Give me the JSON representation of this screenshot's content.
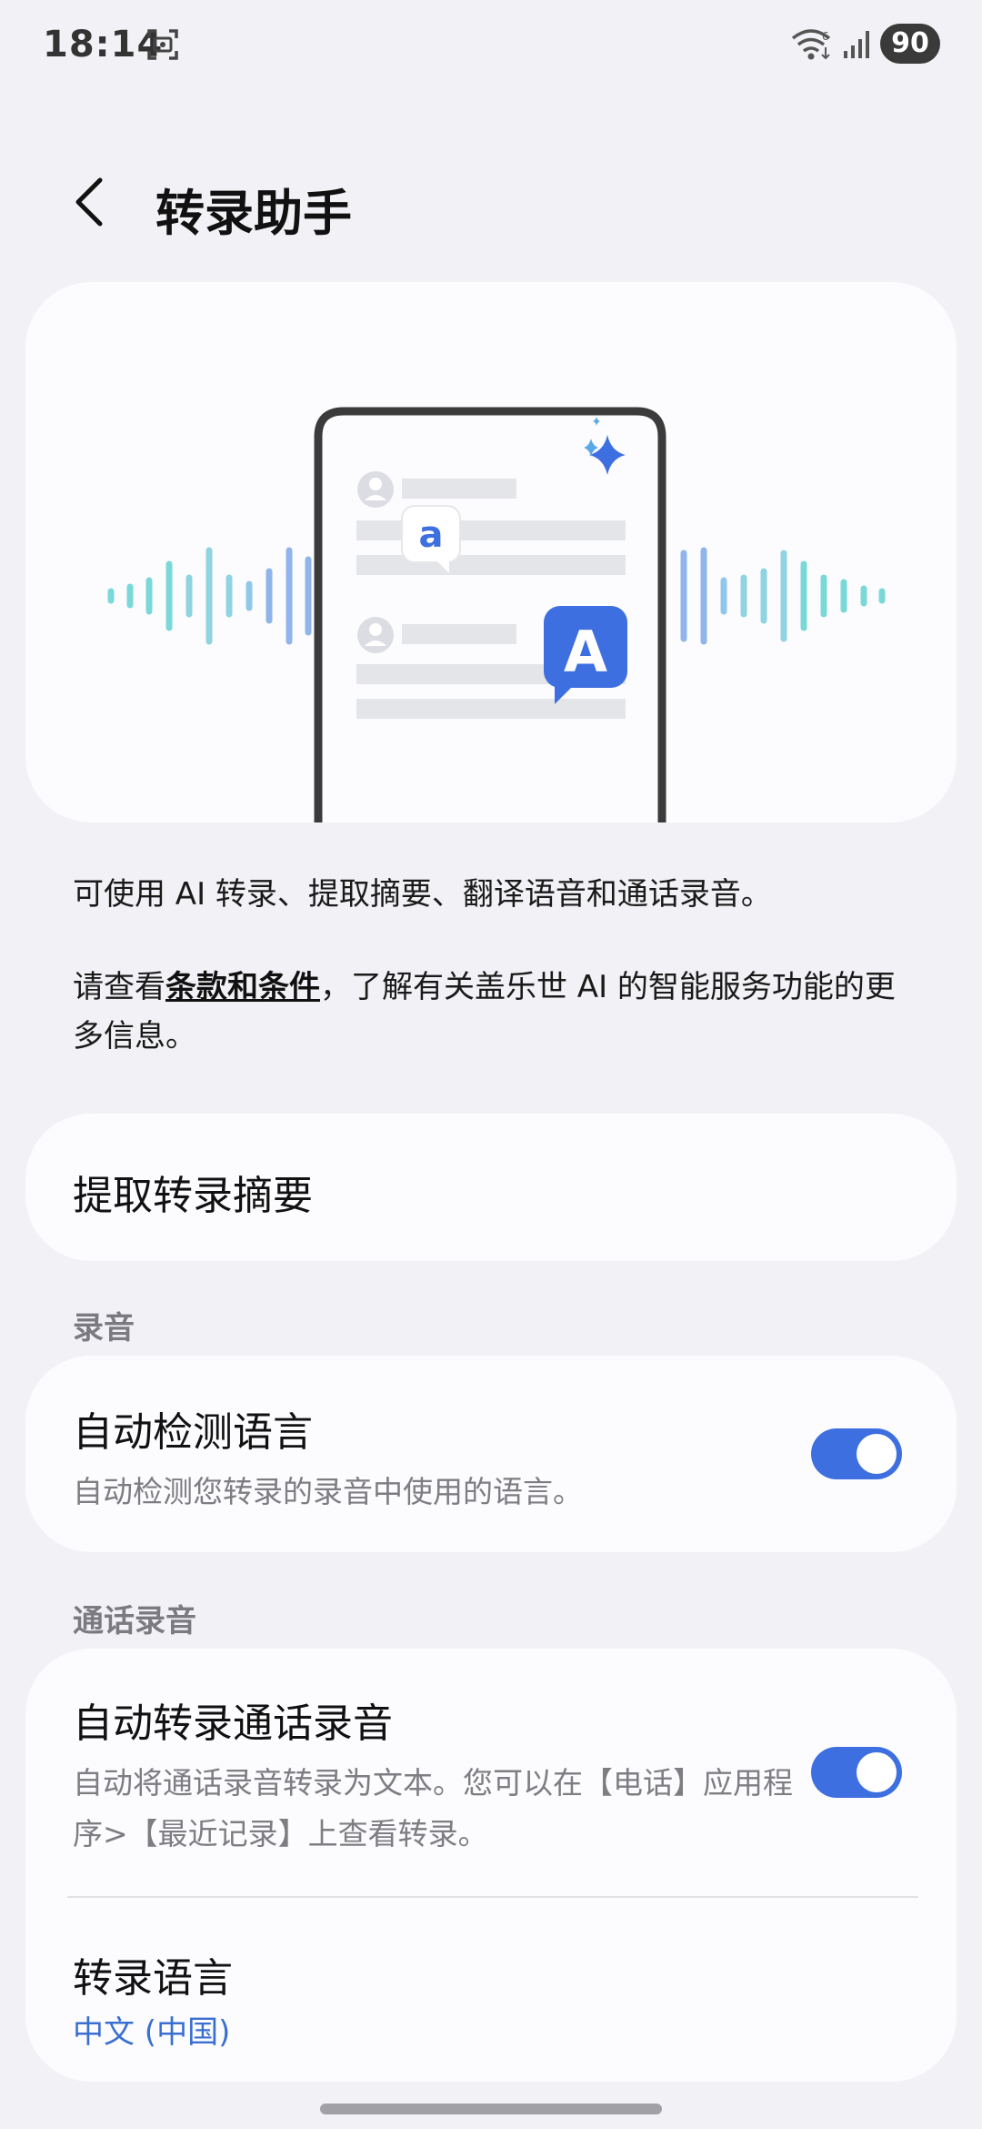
{
  "status_bar": {
    "time": "18:14",
    "battery": "90",
    "icons": [
      "screenshot-icon",
      "wifi-icon",
      "signal-icon"
    ]
  },
  "header": {
    "title": "转录助手",
    "back_icon": "chevron-left-icon"
  },
  "hero": {
    "bubble_small_letter": "a",
    "bubble_large_letter": "A",
    "sparkle_icon": "sparkle-icon",
    "accent_color": "#3d6fe0",
    "wave_color_left": "#7ad9d8",
    "wave_color_right": "#8fb5ea"
  },
  "description": {
    "line1": "可使用 AI 转录、提取摘要、翻译语音和通话录音。",
    "line2_before": "请查看",
    "terms_link": "条款和条件",
    "line2_after": "，了解有关盖乐世 AI 的智能服务功能的更多信息。"
  },
  "summary_row": {
    "title": "提取转录摘要"
  },
  "recording_section": {
    "header": "录音",
    "auto_detect": {
      "title": "自动检测语言",
      "subtitle": "自动检测您转录的录音中使用的语言。",
      "enabled": true
    }
  },
  "call_section": {
    "header": "通话录音",
    "auto_transcribe": {
      "title": "自动转录通话录音",
      "subtitle": "自动将通话录音转录为文本。您可以在【电话】应用程序>【最近记录】上查看转录。",
      "enabled": true
    },
    "language": {
      "title": "转录语言",
      "value": "中文 (中国)"
    }
  },
  "colors": {
    "background": "#f2f2f6",
    "card": "#fcfcfe",
    "toggle_on": "#3d6fe0",
    "link_value": "#3a6fd0"
  }
}
